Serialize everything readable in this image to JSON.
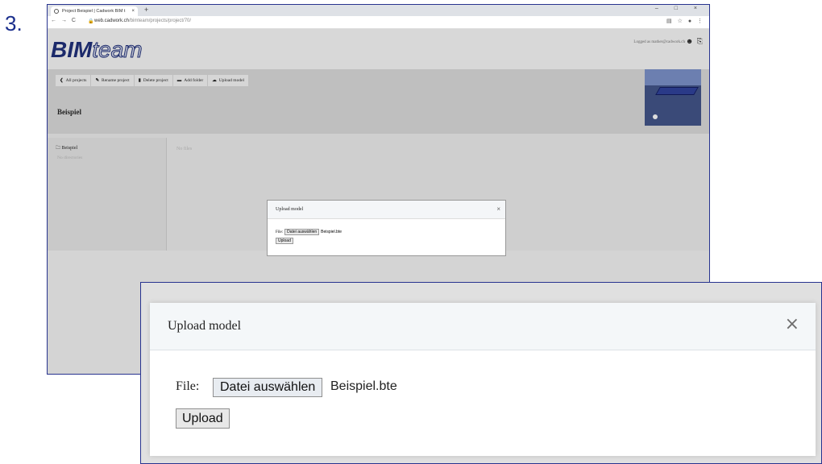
{
  "step_number": "3.",
  "browser": {
    "tab_title": "Project Beispiel | Cadwork BIM t",
    "tab_close": "×",
    "new_tab": "+",
    "window_controls": "–  □  ×",
    "nav_buttons": "← → C",
    "url_domain": "web.cadwork.ch",
    "url_path": "/bimteam/projects/project/70/",
    "toolbar_icons": "▤ ☆ ● ⋮"
  },
  "app": {
    "logo_bold": "BIM",
    "logo_light": "team",
    "logged_in_text": "Logged as mather@cadwork.ch",
    "user_icons": "☻ ⎘",
    "toolbar": [
      {
        "icon": "❮",
        "label": "All projects"
      },
      {
        "icon": "✎",
        "label": "Rename project"
      },
      {
        "icon": "▮",
        "label": "Delete project"
      },
      {
        "icon": "▬",
        "label": "Add folder"
      },
      {
        "icon": "☁",
        "label": "Upload model"
      }
    ],
    "project_title": "Beispiel",
    "folder_name": "Beispiel",
    "no_directories": "No directories",
    "no_files": "No files"
  },
  "modal": {
    "title": "Upload model",
    "close": "×",
    "file_label": "File:",
    "choose_button": "Datei auswählen",
    "file_name": "Beispiel.bte",
    "upload_button": "Upload"
  }
}
